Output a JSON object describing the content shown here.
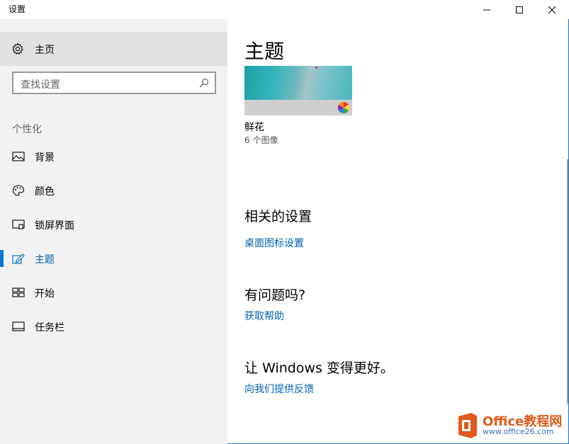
{
  "window": {
    "title": "设置",
    "controls": {
      "minimize": "minimize-icon",
      "maximize": "maximize-icon",
      "close": "close-icon"
    }
  },
  "sidebar": {
    "home_label": "主页",
    "home_icon": "gear-icon",
    "search_placeholder": "查找设置",
    "search_icon": "search-icon",
    "group_label": "个性化",
    "items": [
      {
        "label": "背景",
        "icon": "picture-icon",
        "active": false
      },
      {
        "label": "颜色",
        "icon": "palette-icon",
        "active": false
      },
      {
        "label": "锁屏界面",
        "icon": "lock-screen-icon",
        "active": false
      },
      {
        "label": "主题",
        "icon": "brush-icon",
        "active": true
      },
      {
        "label": "开始",
        "icon": "start-tiles-icon",
        "active": false
      },
      {
        "label": "任务栏",
        "icon": "taskbar-icon",
        "active": false
      }
    ]
  },
  "main": {
    "title": "主题",
    "theme": {
      "name": "鲜花",
      "subtitle": "6 个图像"
    },
    "related": {
      "title": "相关的设置",
      "link": "桌面图标设置"
    },
    "help": {
      "title": "有问题吗?",
      "link": "获取帮助"
    },
    "feedback": {
      "title": "让 Windows 变得更好。",
      "link": "向我们提供反馈"
    }
  },
  "watermark": {
    "brand": "Office教程网",
    "url": "www.office26.com"
  },
  "colors": {
    "accent": "#0078d7",
    "link": "#0063b1",
    "sidebar_bg": "#f2f2f2",
    "watermark_orange": "#e05a1b"
  }
}
